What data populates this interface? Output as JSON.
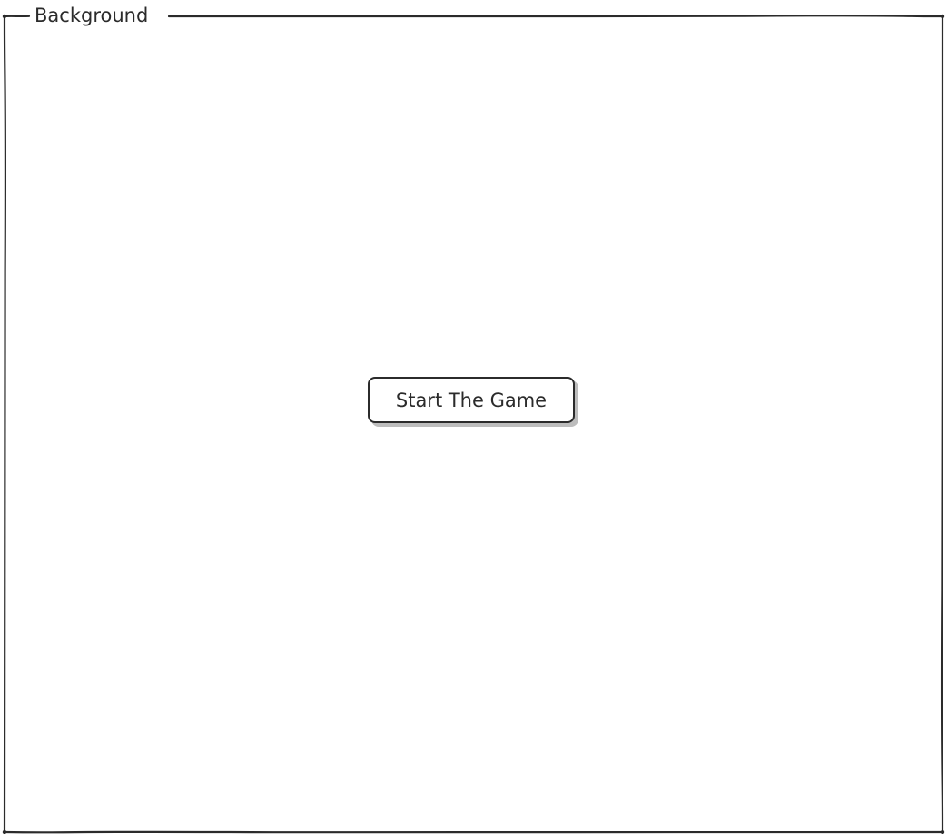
{
  "frame": {
    "title": "Background"
  },
  "main": {
    "start_button_label": "Start The Game"
  }
}
